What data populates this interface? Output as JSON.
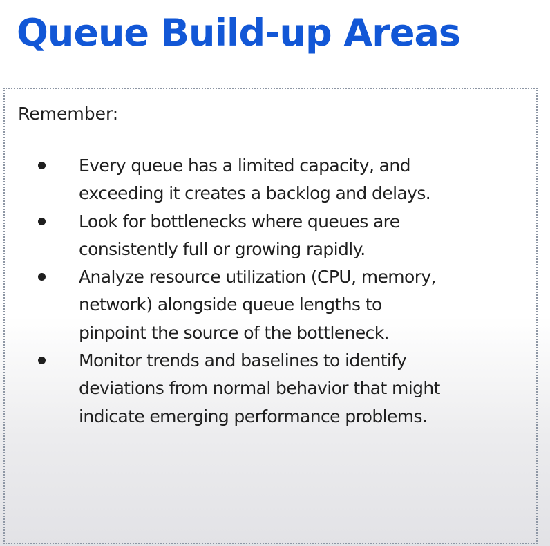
{
  "title": "Queue Build-up Areas",
  "remember_label": "Remember:",
  "bullets": [
    {
      "lines": [
        "Every queue has a limited capacity, and",
        "exceeding it creates a backlog and delays."
      ]
    },
    {
      "lines": [
        "Look for bottlenecks where queues are",
        "consistently full or growing rapidly."
      ]
    },
    {
      "lines": [
        "Analyze resource utilization (CPU, memory,",
        "network) alongside queue lengths to",
        "pinpoint the source of the bottleneck."
      ]
    },
    {
      "lines": [
        "Monitor trends and baselines to identify",
        "deviations from normal behavior that might",
        "indicate emerging performance problems."
      ]
    }
  ],
  "colors": {
    "title": "#1257d6",
    "text": "#1f1f1f",
    "box_border": "#8d96a4"
  }
}
